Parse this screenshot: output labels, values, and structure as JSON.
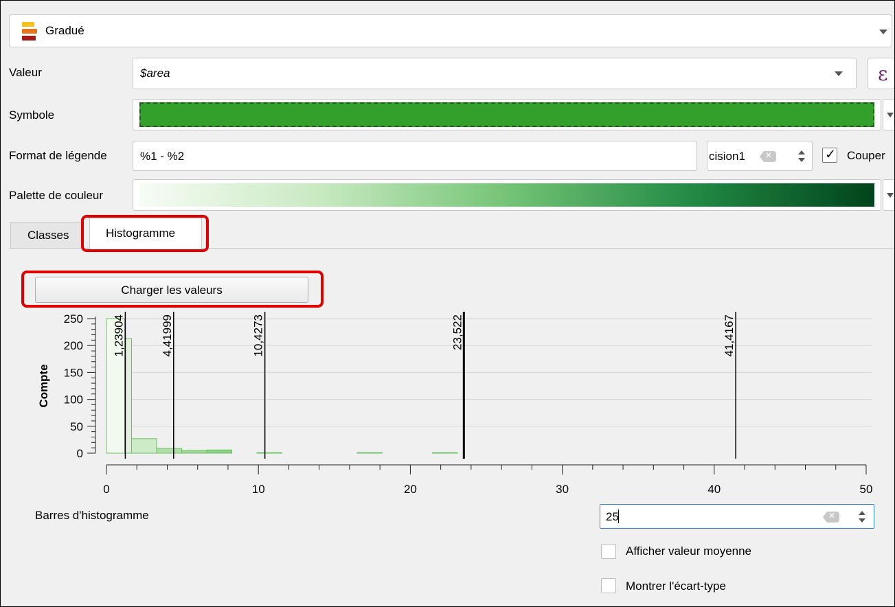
{
  "renderer": {
    "label": "Gradué",
    "icon": "graduated-renderer-icon"
  },
  "value": {
    "label": "Valeur",
    "field": "$area",
    "expression_icon": "ε"
  },
  "symbol": {
    "label": "Symbole",
    "fill_color": "#33a02c",
    "border_color": "#1f5e1c"
  },
  "legend_format": {
    "label": "Format de légende",
    "value": "%1 - %2",
    "precision_text": "cision1",
    "trim_label": "Couper",
    "trim_checked": true
  },
  "color_ramp": {
    "label": "Palette de couleur",
    "stops": [
      "#f7fcf5",
      "#c7e9c0",
      "#74c476",
      "#238b45",
      "#00441b"
    ]
  },
  "tabs": [
    {
      "label": "Classes"
    },
    {
      "label": "Histogramme"
    }
  ],
  "load_button": {
    "label": "Charger les valeurs"
  },
  "bins": {
    "label": "Barres d'histogramme",
    "value": "25"
  },
  "options": {
    "show_mean": {
      "label": "Afficher valeur moyenne",
      "checked": false
    },
    "show_stddev": {
      "label": "Montrer l'écart-type",
      "checked": false
    }
  },
  "chart_data": {
    "type": "bar",
    "ylabel": "Compte",
    "xlim": [
      0,
      50
    ],
    "ylim": [
      0,
      250
    ],
    "x_ticks": [
      0,
      10,
      20,
      30,
      40,
      50
    ],
    "y_ticks": [
      0,
      50,
      100,
      150,
      200,
      250
    ],
    "grid": true,
    "bins": [
      {
        "x0": 0,
        "x1": 1.2,
        "count": 250,
        "color": "#f2faf0"
      },
      {
        "x0": 1.2,
        "x1": 1.65,
        "count": 213,
        "color": "#dff1da"
      },
      {
        "x0": 1.65,
        "x1": 3.3,
        "count": 27,
        "color": "#cdebc6"
      },
      {
        "x0": 3.3,
        "x1": 4.95,
        "count": 9,
        "color": "#b2deaa"
      },
      {
        "x0": 4.95,
        "x1": 6.6,
        "count": 5,
        "color": "#a2d89a"
      },
      {
        "x0": 6.6,
        "x1": 8.25,
        "count": 6,
        "color": "#8fcf86"
      },
      {
        "x0": 9.9,
        "x1": 11.55,
        "count": 1,
        "color": "#7cc574"
      },
      {
        "x0": 16.5,
        "x1": 18.15,
        "count": 1,
        "color": "#3ea64b"
      },
      {
        "x0": 21.45,
        "x1": 23.1,
        "count": 1,
        "color": "#2a9444"
      }
    ],
    "class_breaks": [
      {
        "value": 1.23904,
        "label": "1,23904"
      },
      {
        "value": 4.41999,
        "label": "4,41999"
      },
      {
        "value": 10.4273,
        "label": "10,4273"
      },
      {
        "value": 23.522,
        "label": "23,522"
      },
      {
        "value": 41.4167,
        "label": "41,4167"
      }
    ]
  }
}
